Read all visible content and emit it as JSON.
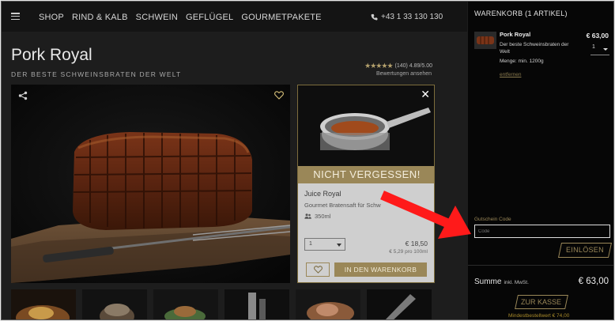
{
  "header": {
    "nav": [
      "SHOP",
      "RIND & KALB",
      "SCHWEIN",
      "GEFLÜGEL",
      "GOURMETPAKETE"
    ],
    "phone": "+43 1 33 130 130"
  },
  "product": {
    "title": "Pork Royal",
    "subtitle": "DER BESTE SCHWEINSBRATEN DER WELT",
    "rating_text": "(140)  4.89/5.00",
    "reviews_link": "Bewertungen ansehen"
  },
  "popup": {
    "banner": "NICHT VERGESSEN!",
    "name": "Juice Royal",
    "description": "Gourmet Bratensaft für Schw",
    "size": "350ml",
    "qty": "1",
    "price": "€ 18,50",
    "unit_price": "€ 5,29 pro 100ml",
    "cart_button": "IN DEN WARENKORB"
  },
  "cart": {
    "title": "WARENKORB (1 ARTIKEL)",
    "item": {
      "name": "Pork Royal",
      "description": "Der beste Schweinsbraten der Welt",
      "quantity_note": "Menge: min. 1200g",
      "price": "€ 63,00",
      "qty": "1",
      "remove": "entfernen"
    },
    "coupon_label": "Gutschein Code",
    "coupon_placeholder": "Code",
    "redeem_button": "EINLÖSEN",
    "sum_label": "Summe",
    "sum_note": "inkl. MwSt.",
    "sum_value": "€ 63,00",
    "checkout_button": "ZUR KASSE",
    "min_order": "Mindestbestellwert € 74,00"
  },
  "colors": {
    "accent": "#9a8758",
    "sidebar_bg": "#060606",
    "annotation_arrow": "#ff1a1a"
  }
}
